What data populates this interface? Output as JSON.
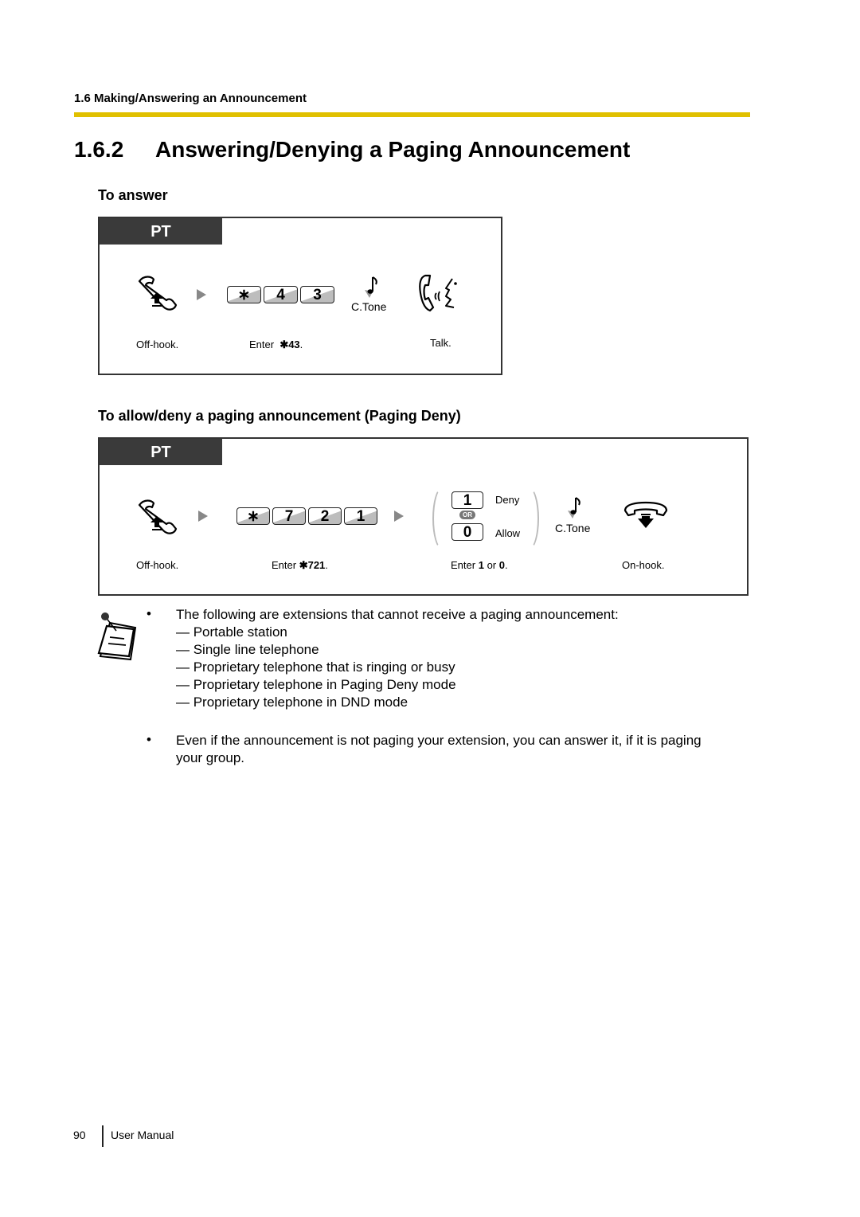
{
  "header": {
    "running_head": "1.6 Making/Answering an Announcement",
    "rule_color": "#e0c000"
  },
  "section": {
    "number": "1.6.2",
    "title": "Answering/Denying a Paging Announcement"
  },
  "answer": {
    "heading": "To answer",
    "tab_label": "PT",
    "keys": [
      "∗",
      "4",
      "3"
    ],
    "tone_label": "C.Tone",
    "steps": {
      "off_hook": "Off-hook.",
      "enter_prefix": "Enter",
      "enter_code": "✱43",
      "enter_suffix": ".",
      "talk": "Talk."
    },
    "icons": [
      "off-hook-icon",
      "arrow-icon",
      "confirmation-tone-icon",
      "talk-icon"
    ]
  },
  "deny": {
    "heading": "To allow/deny a paging announcement (Paging Deny)",
    "tab_label": "PT",
    "keys": [
      "∗",
      "7",
      "2",
      "1"
    ],
    "options": [
      {
        "key": "1",
        "label": "Deny"
      },
      {
        "key": "0",
        "label": "Allow"
      }
    ],
    "or_label": "OR",
    "tone_label": "C.Tone",
    "steps": {
      "off_hook": "Off-hook.",
      "enter_prefix": "Enter",
      "enter_code": "✱721",
      "enter_suffix": ".",
      "choice_prefix": "Enter",
      "choice_a": "1",
      "choice_or": "or",
      "choice_b": "0",
      "choice_suffix": ".",
      "on_hook": "On-hook."
    },
    "icons": [
      "off-hook-icon",
      "arrow-icon",
      "confirmation-tone-icon",
      "on-hook-icon"
    ]
  },
  "notes": {
    "icon": "note-icon",
    "bullet": "•",
    "items": [
      {
        "text": "The following are extensions that cannot receive a paging announcement:",
        "sub": [
          "— Portable station",
          "— Single line telephone",
          "— Proprietary telephone that is ringing or busy",
          "— Proprietary telephone in Paging Deny mode",
          "— Proprietary telephone in DND mode"
        ]
      },
      {
        "text": "Even if the announcement is not paging your extension, you can answer it, if it is paging",
        "text2": "your group."
      }
    ]
  },
  "footer": {
    "page_number": "90",
    "label": "User Manual"
  }
}
